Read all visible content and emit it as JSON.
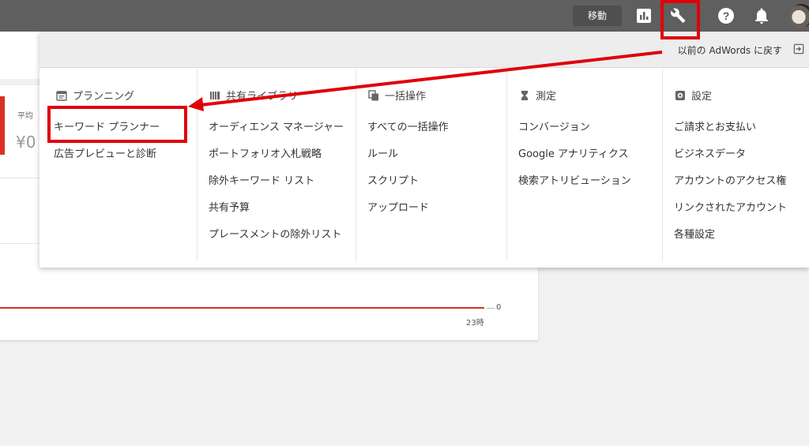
{
  "topbar": {
    "go_label": "移動",
    "icons": [
      "reports-icon",
      "wrench-icon",
      "help-icon",
      "bell-icon",
      "avatar"
    ]
  },
  "background": {
    "metric_label": "平均",
    "metric_value": "¥0",
    "chart_zero": "0",
    "chart_x_label": "23時"
  },
  "menu": {
    "back_link": "以前の AdWords に戻す",
    "columns": [
      {
        "icon": "calendar-icon",
        "title": "プランニング",
        "items": [
          "キーワード プランナー",
          "広告プレビューと診断"
        ]
      },
      {
        "icon": "library-icon",
        "title": "共有ライブラリ",
        "items": [
          "オーディエンス マネージャー",
          "ポートフォリオ入札戦略",
          "除外キーワード リスト",
          "共有予算",
          "プレースメントの除外リスト"
        ]
      },
      {
        "icon": "copy-icon",
        "title": "一括操作",
        "items": [
          "すべての一括操作",
          "ルール",
          "スクリプト",
          "アップロード"
        ]
      },
      {
        "icon": "hourglass-icon",
        "title": "測定",
        "items": [
          "コンバージョン",
          "Google アナリティクス",
          "検索アトリビューション"
        ]
      },
      {
        "icon": "gear-icon",
        "title": "設定",
        "items": [
          "ご請求とお支払い",
          "ビジネスデータ",
          "アカウントのアクセス権",
          "リンクされたアカウント",
          "各種設定"
        ]
      }
    ]
  },
  "colors": {
    "topbar": "#5f5f5f",
    "highlight": "#e0000b",
    "chart_line": "#d93025"
  }
}
